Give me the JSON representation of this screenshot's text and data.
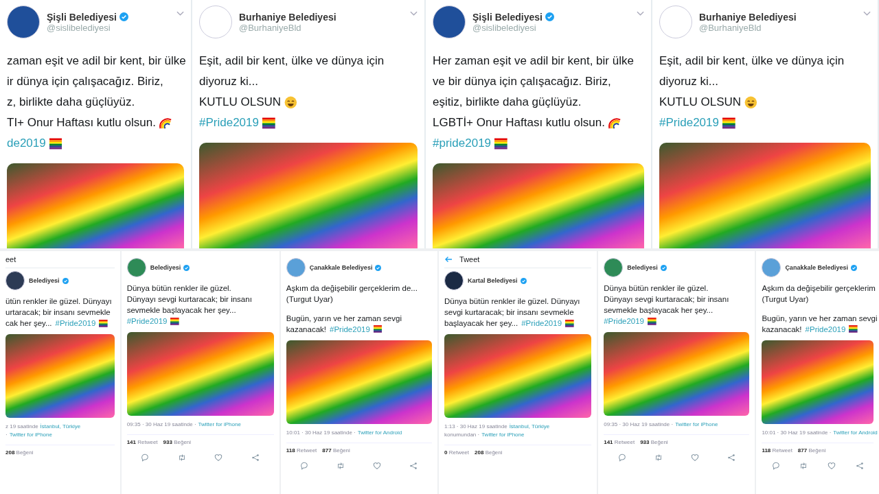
{
  "top_tweets": [
    {
      "name": "Şişli Belediyesi",
      "verified": true,
      "handle": "@sislibelediyesi",
      "color": "#1f4f9a",
      "lines": [
        [
          {
            "kind": "text",
            "t": "zaman eşit ve adil bir kent, bir ülke"
          }
        ],
        [
          {
            "kind": "text",
            "t": "ir dünya için çalışacağız. Biriz,"
          }
        ],
        [
          {
            "kind": "text",
            "t": "z, birlikte daha güçlüyüz."
          }
        ],
        [
          {
            "kind": "text",
            "t": "TI+ Onur Haftası kutlu olsun."
          },
          {
            "kind": "rainbow"
          }
        ],
        [
          {
            "kind": "tag",
            "t": "de2019"
          },
          {
            "kind": "flag"
          }
        ]
      ]
    },
    {
      "name": "Burhaniye Belediyesi",
      "verified": false,
      "handle": "@BurhaniyeBld",
      "color": "#ffffff",
      "lines": [
        [
          {
            "kind": "text",
            "t": "Eşit, adil bir kent, ülke ve dünya için"
          }
        ],
        [
          {
            "kind": "text",
            "t": "diyoruz ki..."
          }
        ],
        [
          {
            "kind": "text",
            "t": "KUTLU OLSUN"
          },
          {
            "kind": "smile"
          }
        ],
        [
          {
            "kind": "tag",
            "t": "#Pride2019"
          },
          {
            "kind": "flag"
          }
        ]
      ]
    },
    {
      "name": "Şişli Belediyesi",
      "verified": true,
      "handle": "@sislibelediyesi",
      "color": "#1f4f9a",
      "lines": [
        [
          {
            "kind": "text",
            "t": "Her zaman eşit ve adil bir kent, bir ülke"
          }
        ],
        [
          {
            "kind": "text",
            "t": "ve bir dünya için çalışacağız. Biriz,"
          }
        ],
        [
          {
            "kind": "text",
            "t": "eşitiz, birlikte daha güçlüyüz."
          }
        ],
        [
          {
            "kind": "text",
            "t": "LGBTİ+ Onur Haftası kutlu olsun."
          },
          {
            "kind": "rainbow"
          }
        ],
        [
          {
            "kind": "tag",
            "t": "#pride2019"
          },
          {
            "kind": "flag"
          }
        ]
      ]
    },
    {
      "name": "Burhaniye Belediyesi",
      "verified": false,
      "handle": "@BurhaniyeBld",
      "color": "#ffffff",
      "lines": [
        [
          {
            "kind": "text",
            "t": "Eşit, adil bir kent, ülke ve dünya için"
          }
        ],
        [
          {
            "kind": "text",
            "t": "diyoruz ki..."
          }
        ],
        [
          {
            "kind": "text",
            "t": "KUTLU OLSUN"
          },
          {
            "kind": "smile"
          }
        ],
        [
          {
            "kind": "tag",
            "t": "#Pride2019"
          },
          {
            "kind": "flag"
          }
        ]
      ]
    }
  ],
  "bottom_tweets": [
    {
      "header": {
        "title": "eet",
        "back": false
      },
      "name": "Belediyesi",
      "verified": true,
      "color": "#2d3b55",
      "lines": [
        [
          {
            "kind": "text",
            "t": "ütün renkler ile güzel. Dünyayı"
          }
        ],
        [
          {
            "kind": "text",
            "t": "urtaracak; bir insanı sevmekle"
          }
        ],
        [
          {
            "kind": "text",
            "t": "cak her şey..."
          },
          {
            "kind": "tag",
            "t": "#Pride2019"
          },
          {
            "kind": "flag"
          }
        ]
      ],
      "meta": [
        [
          {
            "kind": "text",
            "t": "z 19 saatinde"
          },
          {
            "kind": "tag",
            "t": "İstanbul, Türkiye"
          }
        ],
        [
          {
            "kind": "text",
            "t": "·"
          },
          {
            "kind": "tag",
            "t": "Twitter for iPhone"
          }
        ]
      ],
      "stats": [
        {
          "n": "208",
          "label": "Beğeni"
        }
      ],
      "actions": false
    },
    {
      "name": "Belediyesi",
      "verified": true,
      "color": "#2e8b57",
      "lines": [
        [
          {
            "kind": "text",
            "t": "Dünya bütün renkler ile güzel."
          }
        ],
        [
          {
            "kind": "text",
            "t": "Dünyayı sevgi kurtaracak; bir insanı"
          }
        ],
        [
          {
            "kind": "text",
            "t": "sevmekle başlayacak her şey..."
          }
        ],
        [
          {
            "kind": "tag",
            "t": "#Pride2019"
          },
          {
            "kind": "flag"
          }
        ]
      ],
      "meta": [
        [
          {
            "kind": "text",
            "t": "09:35 · 30 Haz 19 saatinde ·"
          },
          {
            "kind": "tag",
            "t": "Twitter for iPhone"
          }
        ]
      ],
      "stats": [
        {
          "n": "141",
          "label": "Retweet"
        },
        {
          "n": "933",
          "label": "Beğeni"
        }
      ],
      "actions": true
    },
    {
      "name": "Çanakkale Belediyesi",
      "verified": true,
      "color": "#5aa0d8",
      "lines": [
        [
          {
            "kind": "text",
            "t": "Aşkım da değişebilir gerçeklerim de..."
          }
        ],
        [
          {
            "kind": "text",
            "t": "(Turgut Uyar)"
          }
        ],
        [
          {
            "kind": "break"
          }
        ],
        [
          {
            "kind": "text",
            "t": "Bugün, yarın ve her zaman sevgi"
          }
        ],
        [
          {
            "kind": "text",
            "t": "kazanacak!"
          },
          {
            "kind": "tag",
            "t": "#Pride2019"
          },
          {
            "kind": "flag"
          }
        ]
      ],
      "meta": [
        [
          {
            "kind": "text",
            "t": "10:01 · 30 Haz 19 saatinde ·"
          },
          {
            "kind": "tag",
            "t": "Twitter for Android"
          }
        ]
      ],
      "stats": [
        {
          "n": "118",
          "label": "Retweet"
        },
        {
          "n": "877",
          "label": "Beğeni"
        }
      ],
      "actions": true
    },
    {
      "header": {
        "title": "Tweet",
        "back": true
      },
      "name": "Kartal Belediyesi",
      "verified": true,
      "color": "#1b2a44",
      "lines": [
        [
          {
            "kind": "text",
            "t": "Dünya bütün renkler ile güzel. Dünyayı"
          }
        ],
        [
          {
            "kind": "text",
            "t": "sevgi kurtaracak; bir insanı sevmekle"
          }
        ],
        [
          {
            "kind": "text",
            "t": "başlayacak her şey..."
          },
          {
            "kind": "tag",
            "t": "#Pride2019"
          },
          {
            "kind": "flag"
          }
        ]
      ],
      "meta": [
        [
          {
            "kind": "text",
            "t": "1:13 · 30 Haz 19 saatinde"
          },
          {
            "kind": "tag",
            "t": "İstanbul, Türkiye"
          }
        ],
        [
          {
            "kind": "text",
            "t": "konumundan ·"
          },
          {
            "kind": "tag",
            "t": "Twitter for iPhone"
          }
        ]
      ],
      "stats": [
        {
          "n": "0",
          "label": "Retweet"
        },
        {
          "n": "208",
          "label": "Beğeni"
        }
      ],
      "actions": false
    },
    {
      "name": "Belediyesi",
      "verified": true,
      "color": "#2e8b57",
      "lines": [
        [
          {
            "kind": "text",
            "t": "Dünya bütün renkler ile güzel."
          }
        ],
        [
          {
            "kind": "text",
            "t": "Dünyayı sevgi kurtaracak; bir insanı"
          }
        ],
        [
          {
            "kind": "text",
            "t": "sevmekle başlayacak her şey..."
          }
        ],
        [
          {
            "kind": "tag",
            "t": "#Pride2019"
          },
          {
            "kind": "flag"
          }
        ]
      ],
      "meta": [
        [
          {
            "kind": "text",
            "t": "09:35 · 30 Haz 19 saatinde ·"
          },
          {
            "kind": "tag",
            "t": "Twitter for iPhone"
          }
        ]
      ],
      "stats": [
        {
          "n": "141",
          "label": "Retweet"
        },
        {
          "n": "933",
          "label": "Beğeni"
        }
      ],
      "actions": true
    },
    {
      "name": "Çanakkale Belediyesi",
      "verified": true,
      "color": "#5aa0d8",
      "lines": [
        [
          {
            "kind": "text",
            "t": "Aşkım da değişebilir gerçeklerim"
          }
        ],
        [
          {
            "kind": "text",
            "t": "(Turgut Uyar)"
          }
        ],
        [
          {
            "kind": "break"
          }
        ],
        [
          {
            "kind": "text",
            "t": "Bugün, yarın ve her zaman sevgi"
          }
        ],
        [
          {
            "kind": "text",
            "t": "kazanacak!"
          },
          {
            "kind": "tag",
            "t": "#Pride2019"
          },
          {
            "kind": "flag"
          }
        ]
      ],
      "meta": [
        [
          {
            "kind": "text",
            "t": "10:01 · 30 Haz 19 saatinde ·"
          },
          {
            "kind": "tag",
            "t": "Twitter for Android"
          }
        ]
      ],
      "stats": [
        {
          "n": "118",
          "label": "Retweet"
        },
        {
          "n": "877",
          "label": "Beğeni"
        }
      ],
      "actions": true
    }
  ]
}
